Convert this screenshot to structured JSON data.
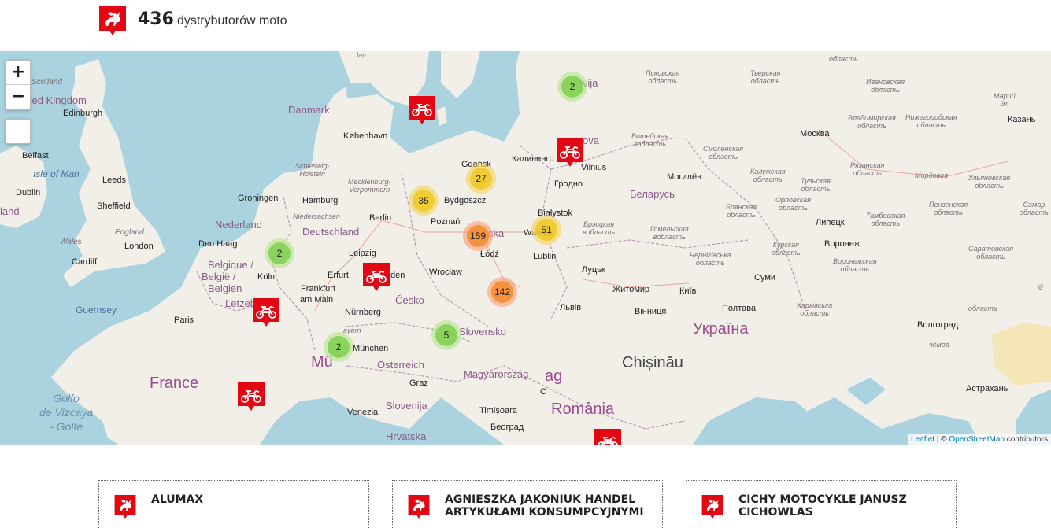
{
  "header": {
    "count": "436",
    "label": "dystrybutorów moto",
    "logo_icon": "pegasus-logo-icon"
  },
  "map": {
    "controls": {
      "zoom_in": "+",
      "zoom_out": "−"
    },
    "countries": {
      "danmark": "Danmark",
      "deutschland": "Deutschland",
      "nederland": "Nederland",
      "belgique": "Belgique /",
      "belgie": "België /",
      "belgien": "Belgien",
      "letzebuerg": "Letzebuerg",
      "france": "France",
      "cesko": "Česko",
      "osterreich": "Österreich",
      "slovensko": "Slovensko",
      "magyarorszag": "Magyarország",
      "slovenija": "Slovenija",
      "hrvatska": "Hrvatska",
      "romania": "România",
      "ukraina": "Україна",
      "belarus": "Беларусь",
      "united_kingdom": "ited Kingdom",
      "ireland": "land",
      "lt": "vija",
      "lithuania": "ova",
      "polska": "ska",
      "mu": "Mü",
      "ag": "ag"
    },
    "cities": {
      "edinburgh": "Edinburgh",
      "belfast": "Belfast",
      "dublin": "Dublin",
      "leeds": "Leeds",
      "sheffield": "Sheffield",
      "london": "London",
      "cardiff": "Cardiff",
      "paris": "Paris",
      "den_haag": "Den Haag",
      "koln": "Köln",
      "frankfurt": "Frankfurt",
      "frankfurt2": "am Main",
      "erfurt": "Erfurt",
      "leipzig": "Leipzig",
      "berlin": "Berlin",
      "hamburg": "Hamburg",
      "groningen": "Groningen",
      "kobenhavn": "København",
      "gdansk": "Gdańsk",
      "bydgoszcz": "Bydgoszcz",
      "poznan": "Poznań",
      "lodz": "Łódź",
      "wroclaw": "Wrocław",
      "warszawa": "Warsza",
      "bialystok": "Białystok",
      "lublin": "Lublin",
      "kaliningrad": "Калинингр",
      "vilnius": "Vilnius",
      "grodno": "Гродно",
      "nurnberg": "Nürnberg",
      "munchen": "München",
      "graz": "Graz",
      "venezia": "Venezia",
      "timisoara": "Timișoara",
      "beograd": "Београд",
      "chisinau": "Chișinău",
      "lviv": "Львів",
      "lutsk": "Луцьк",
      "zhytomyr": "Житомир",
      "kyiv": "Київ",
      "vinnytsia": "Вінниця",
      "poltava": "Полтава",
      "sumy": "Суми",
      "moskva": "Москва",
      "mogilev": "Могилёв",
      "lipetsk": "Липецк",
      "voronezh": "Воронеж",
      "kazan": "Казань",
      "astrakhan": "Астрахань",
      "volgograd": "Волгоград",
      "en": "den",
      "c": "C"
    },
    "regions": {
      "scotland": "Scotland",
      "isle_of_man": "Isle of Man",
      "wales": "Wales",
      "england": "England",
      "schleswig": "Schleswig-\nHolstein",
      "mecklenburg": "Mecklenburg-\nVorpommern",
      "niedersachsen": "Niedersachsen",
      "guernsey": "Guernsey",
      "golfo": "Golfo\nde Vizcaya\n- Golfe",
      "bayern": "ayern",
      "pskov": "Псковская\nобласть",
      "tver": "Тверская\nобласть",
      "ivanovo": "Ивановская\nобласть",
      "vitebsk": "Витебская\nвобласть",
      "smolensk": "Смоленская\nобласть",
      "kaluga": "Калужская\nобласть",
      "tula": "Тульская\nобласть",
      "ryazan": "Рязанская\nобласть",
      "mordovia": "Мордовия",
      "ulyanovsk": "Ульяновская\nобласть",
      "penza": "Пензенская\nобласть",
      "tambov": "Тамбовская\nобласть",
      "saratov": "Саратовская\nобласть",
      "bryansk": "Брянская\nобласть",
      "oryol": "Орловская\nобласть",
      "kursk": "Курская\nобласть",
      "voronezh_r": "Воронежская\nобласть",
      "brest": "Брэсцкая\nвобласть",
      "gomel": "Гомельская\nвобласть",
      "chernihiv": "Чернігівська\nобласть",
      "kharkiv": "Харківська\nобласть",
      "nizhny": "Нижегородская\nобласть",
      "vladimir": "Владимирская\nобласть",
      "mari": "Марий\nЭл",
      "yaroslavl": "область",
      "samara": "Самар\nобласть",
      "volgograd_r": "область",
      "chuvash": "чёмов",
      "iy": "ій",
      "lan": "lan"
    },
    "clusters": [
      {
        "id": "latvia",
        "count": "2",
        "level": "green"
      },
      {
        "id": "gdansk",
        "count": "27",
        "level": "yellow"
      },
      {
        "id": "bydgoszcz",
        "count": "35",
        "level": "yellow"
      },
      {
        "id": "lodz",
        "count": "159",
        "level": "orange"
      },
      {
        "id": "warszawa",
        "count": "51",
        "level": "yellow"
      },
      {
        "id": "krakow",
        "count": "142",
        "level": "orange"
      },
      {
        "id": "nl",
        "count": "2",
        "level": "green"
      },
      {
        "id": "wien",
        "count": "5",
        "level": "green"
      },
      {
        "id": "munchen",
        "count": "2",
        "level": "green"
      }
    ],
    "attribution": {
      "leaflet": "Leaflet",
      "sep": " | © ",
      "osm": "OpenStreetMap",
      "rest": " contributors"
    }
  },
  "cards": [
    {
      "name": "ALUMAX",
      "icon": "pegasus-logo-icon"
    },
    {
      "name": "AGNIESZKA JAKONIUK HANDEL ARTYKUŁAMI KONSUMPCYJNYMI",
      "icon": "pegasus-logo-icon"
    },
    {
      "name": "CICHY MOTOCYKLE JANUSZ CICHOWLAS",
      "icon": "pegasus-logo-icon"
    }
  ],
  "colors": {
    "brand": "#e30613",
    "water": "#aad3df",
    "land": "#f2efe9"
  }
}
